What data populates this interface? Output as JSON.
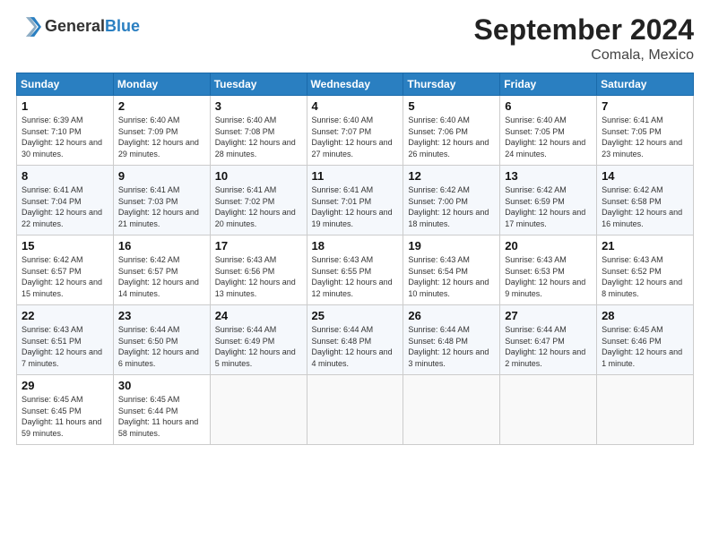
{
  "header": {
    "logo_general": "General",
    "logo_blue": "Blue",
    "title": "September 2024",
    "location": "Comala, Mexico"
  },
  "columns": [
    "Sunday",
    "Monday",
    "Tuesday",
    "Wednesday",
    "Thursday",
    "Friday",
    "Saturday"
  ],
  "weeks": [
    [
      {
        "day": "1",
        "sunrise": "Sunrise: 6:39 AM",
        "sunset": "Sunset: 7:10 PM",
        "daylight": "Daylight: 12 hours and 30 minutes."
      },
      {
        "day": "2",
        "sunrise": "Sunrise: 6:40 AM",
        "sunset": "Sunset: 7:09 PM",
        "daylight": "Daylight: 12 hours and 29 minutes."
      },
      {
        "day": "3",
        "sunrise": "Sunrise: 6:40 AM",
        "sunset": "Sunset: 7:08 PM",
        "daylight": "Daylight: 12 hours and 28 minutes."
      },
      {
        "day": "4",
        "sunrise": "Sunrise: 6:40 AM",
        "sunset": "Sunset: 7:07 PM",
        "daylight": "Daylight: 12 hours and 27 minutes."
      },
      {
        "day": "5",
        "sunrise": "Sunrise: 6:40 AM",
        "sunset": "Sunset: 7:06 PM",
        "daylight": "Daylight: 12 hours and 26 minutes."
      },
      {
        "day": "6",
        "sunrise": "Sunrise: 6:40 AM",
        "sunset": "Sunset: 7:05 PM",
        "daylight": "Daylight: 12 hours and 24 minutes."
      },
      {
        "day": "7",
        "sunrise": "Sunrise: 6:41 AM",
        "sunset": "Sunset: 7:05 PM",
        "daylight": "Daylight: 12 hours and 23 minutes."
      }
    ],
    [
      {
        "day": "8",
        "sunrise": "Sunrise: 6:41 AM",
        "sunset": "Sunset: 7:04 PM",
        "daylight": "Daylight: 12 hours and 22 minutes."
      },
      {
        "day": "9",
        "sunrise": "Sunrise: 6:41 AM",
        "sunset": "Sunset: 7:03 PM",
        "daylight": "Daylight: 12 hours and 21 minutes."
      },
      {
        "day": "10",
        "sunrise": "Sunrise: 6:41 AM",
        "sunset": "Sunset: 7:02 PM",
        "daylight": "Daylight: 12 hours and 20 minutes."
      },
      {
        "day": "11",
        "sunrise": "Sunrise: 6:41 AM",
        "sunset": "Sunset: 7:01 PM",
        "daylight": "Daylight: 12 hours and 19 minutes."
      },
      {
        "day": "12",
        "sunrise": "Sunrise: 6:42 AM",
        "sunset": "Sunset: 7:00 PM",
        "daylight": "Daylight: 12 hours and 18 minutes."
      },
      {
        "day": "13",
        "sunrise": "Sunrise: 6:42 AM",
        "sunset": "Sunset: 6:59 PM",
        "daylight": "Daylight: 12 hours and 17 minutes."
      },
      {
        "day": "14",
        "sunrise": "Sunrise: 6:42 AM",
        "sunset": "Sunset: 6:58 PM",
        "daylight": "Daylight: 12 hours and 16 minutes."
      }
    ],
    [
      {
        "day": "15",
        "sunrise": "Sunrise: 6:42 AM",
        "sunset": "Sunset: 6:57 PM",
        "daylight": "Daylight: 12 hours and 15 minutes."
      },
      {
        "day": "16",
        "sunrise": "Sunrise: 6:42 AM",
        "sunset": "Sunset: 6:57 PM",
        "daylight": "Daylight: 12 hours and 14 minutes."
      },
      {
        "day": "17",
        "sunrise": "Sunrise: 6:43 AM",
        "sunset": "Sunset: 6:56 PM",
        "daylight": "Daylight: 12 hours and 13 minutes."
      },
      {
        "day": "18",
        "sunrise": "Sunrise: 6:43 AM",
        "sunset": "Sunset: 6:55 PM",
        "daylight": "Daylight: 12 hours and 12 minutes."
      },
      {
        "day": "19",
        "sunrise": "Sunrise: 6:43 AM",
        "sunset": "Sunset: 6:54 PM",
        "daylight": "Daylight: 12 hours and 10 minutes."
      },
      {
        "day": "20",
        "sunrise": "Sunrise: 6:43 AM",
        "sunset": "Sunset: 6:53 PM",
        "daylight": "Daylight: 12 hours and 9 minutes."
      },
      {
        "day": "21",
        "sunrise": "Sunrise: 6:43 AM",
        "sunset": "Sunset: 6:52 PM",
        "daylight": "Daylight: 12 hours and 8 minutes."
      }
    ],
    [
      {
        "day": "22",
        "sunrise": "Sunrise: 6:43 AM",
        "sunset": "Sunset: 6:51 PM",
        "daylight": "Daylight: 12 hours and 7 minutes."
      },
      {
        "day": "23",
        "sunrise": "Sunrise: 6:44 AM",
        "sunset": "Sunset: 6:50 PM",
        "daylight": "Daylight: 12 hours and 6 minutes."
      },
      {
        "day": "24",
        "sunrise": "Sunrise: 6:44 AM",
        "sunset": "Sunset: 6:49 PM",
        "daylight": "Daylight: 12 hours and 5 minutes."
      },
      {
        "day": "25",
        "sunrise": "Sunrise: 6:44 AM",
        "sunset": "Sunset: 6:48 PM",
        "daylight": "Daylight: 12 hours and 4 minutes."
      },
      {
        "day": "26",
        "sunrise": "Sunrise: 6:44 AM",
        "sunset": "Sunset: 6:48 PM",
        "daylight": "Daylight: 12 hours and 3 minutes."
      },
      {
        "day": "27",
        "sunrise": "Sunrise: 6:44 AM",
        "sunset": "Sunset: 6:47 PM",
        "daylight": "Daylight: 12 hours and 2 minutes."
      },
      {
        "day": "28",
        "sunrise": "Sunrise: 6:45 AM",
        "sunset": "Sunset: 6:46 PM",
        "daylight": "Daylight: 12 hours and 1 minute."
      }
    ],
    [
      {
        "day": "29",
        "sunrise": "Sunrise: 6:45 AM",
        "sunset": "Sunset: 6:45 PM",
        "daylight": "Daylight: 11 hours and 59 minutes."
      },
      {
        "day": "30",
        "sunrise": "Sunrise: 6:45 AM",
        "sunset": "Sunset: 6:44 PM",
        "daylight": "Daylight: 11 hours and 58 minutes."
      },
      null,
      null,
      null,
      null,
      null
    ]
  ]
}
